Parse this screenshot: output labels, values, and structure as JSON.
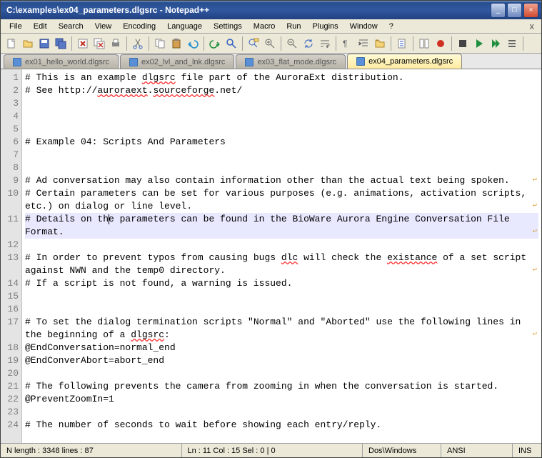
{
  "window": {
    "title": "C:\\examples\\ex04_parameters.dlgsrc - Notepad++"
  },
  "menu": {
    "items": [
      "File",
      "Edit",
      "Search",
      "View",
      "Encoding",
      "Language",
      "Settings",
      "Macro",
      "Run",
      "Plugins",
      "Window",
      "?"
    ]
  },
  "tabs": {
    "items": [
      "ex01_hello_world.dlgsrc",
      "ex02_lvl_and_lnk.dlgsrc",
      "ex03_flat_mode.dlgsrc",
      "ex04_parameters.dlgsrc"
    ],
    "active": 3
  },
  "lines": [
    {
      "n": 1,
      "t": "# This is an example dlgsrc file part of the AuroraExt distribution.",
      "u": [
        [
          "dlgsrc"
        ]
      ]
    },
    {
      "n": 2,
      "t": "# See http://auroraext.sourceforge.net/",
      "u": [
        [
          "auroraext"
        ],
        [
          "sourceforge"
        ]
      ]
    },
    {
      "n": 3,
      "t": ""
    },
    {
      "n": 4,
      "t": ""
    },
    {
      "n": 5,
      "t": ""
    },
    {
      "n": 6,
      "t": "# Example 04: Scripts And Parameters"
    },
    {
      "n": 7,
      "t": ""
    },
    {
      "n": 8,
      "t": ""
    },
    {
      "n": 9,
      "t": "# Ad conversation may also contain information other than the actual text being spoken.",
      "wrap": true
    },
    {
      "n": 10,
      "t": "# Certain parameters can be set for various purposes (e.g. animations, activation scripts, etc.) on dialog or line level.",
      "wrap": true
    },
    {
      "n": 11,
      "t": "# Details on the parameters can be found in the BioWare Aurora Engine Conversation File Format.",
      "hl": true,
      "wrap": true,
      "cur": 15
    },
    {
      "n": 12,
      "t": ""
    },
    {
      "n": 13,
      "t": "# In order to prevent typos from causing bugs dlc will check the existance of a set script against NWN and the temp0 directory.",
      "wrap": true,
      "u": [
        [
          "dlc"
        ],
        [
          "existance"
        ]
      ]
    },
    {
      "n": 14,
      "t": "# If a script is not found, a warning is issued."
    },
    {
      "n": 15,
      "t": ""
    },
    {
      "n": 16,
      "t": ""
    },
    {
      "n": 17,
      "t": "# To set the dialog termination scripts \"Normal\" and \"Aborted\" use the following lines in the beginning of a dlgsrc:",
      "wrap": true,
      "u": [
        [
          "dlgsrc"
        ]
      ]
    },
    {
      "n": 18,
      "t": "@EndConversation=normal_end"
    },
    {
      "n": 19,
      "t": "@EndConverAbort=abort_end"
    },
    {
      "n": 20,
      "t": ""
    },
    {
      "n": 21,
      "t": "# The following prevents the camera from zooming in when the conversation is started."
    },
    {
      "n": 22,
      "t": "@PreventZoomIn=1"
    },
    {
      "n": 23,
      "t": ""
    },
    {
      "n": 24,
      "t": "# The number of seconds to wait before showing each entry/reply."
    }
  ],
  "status": {
    "cell1": "N length : 3348    lines : 87",
    "cell2": "Ln : 11   Col : 15   Sel : 0 | 0",
    "cell3": "Dos\\Windows",
    "cell4": "ANSI",
    "cell5": "INS"
  },
  "toolbar_icons": [
    "new",
    "open",
    "save",
    "save-all",
    "close",
    "close-all",
    "print",
    "cut",
    "copy",
    "paste",
    "undo",
    "redo",
    "find",
    "replace",
    "zoom-in",
    "zoom-out",
    "sync",
    "wordwrap",
    "invisible",
    "indent",
    "folder",
    "doc1",
    "doc2",
    "record",
    "stop",
    "play",
    "play-multi",
    "list"
  ]
}
